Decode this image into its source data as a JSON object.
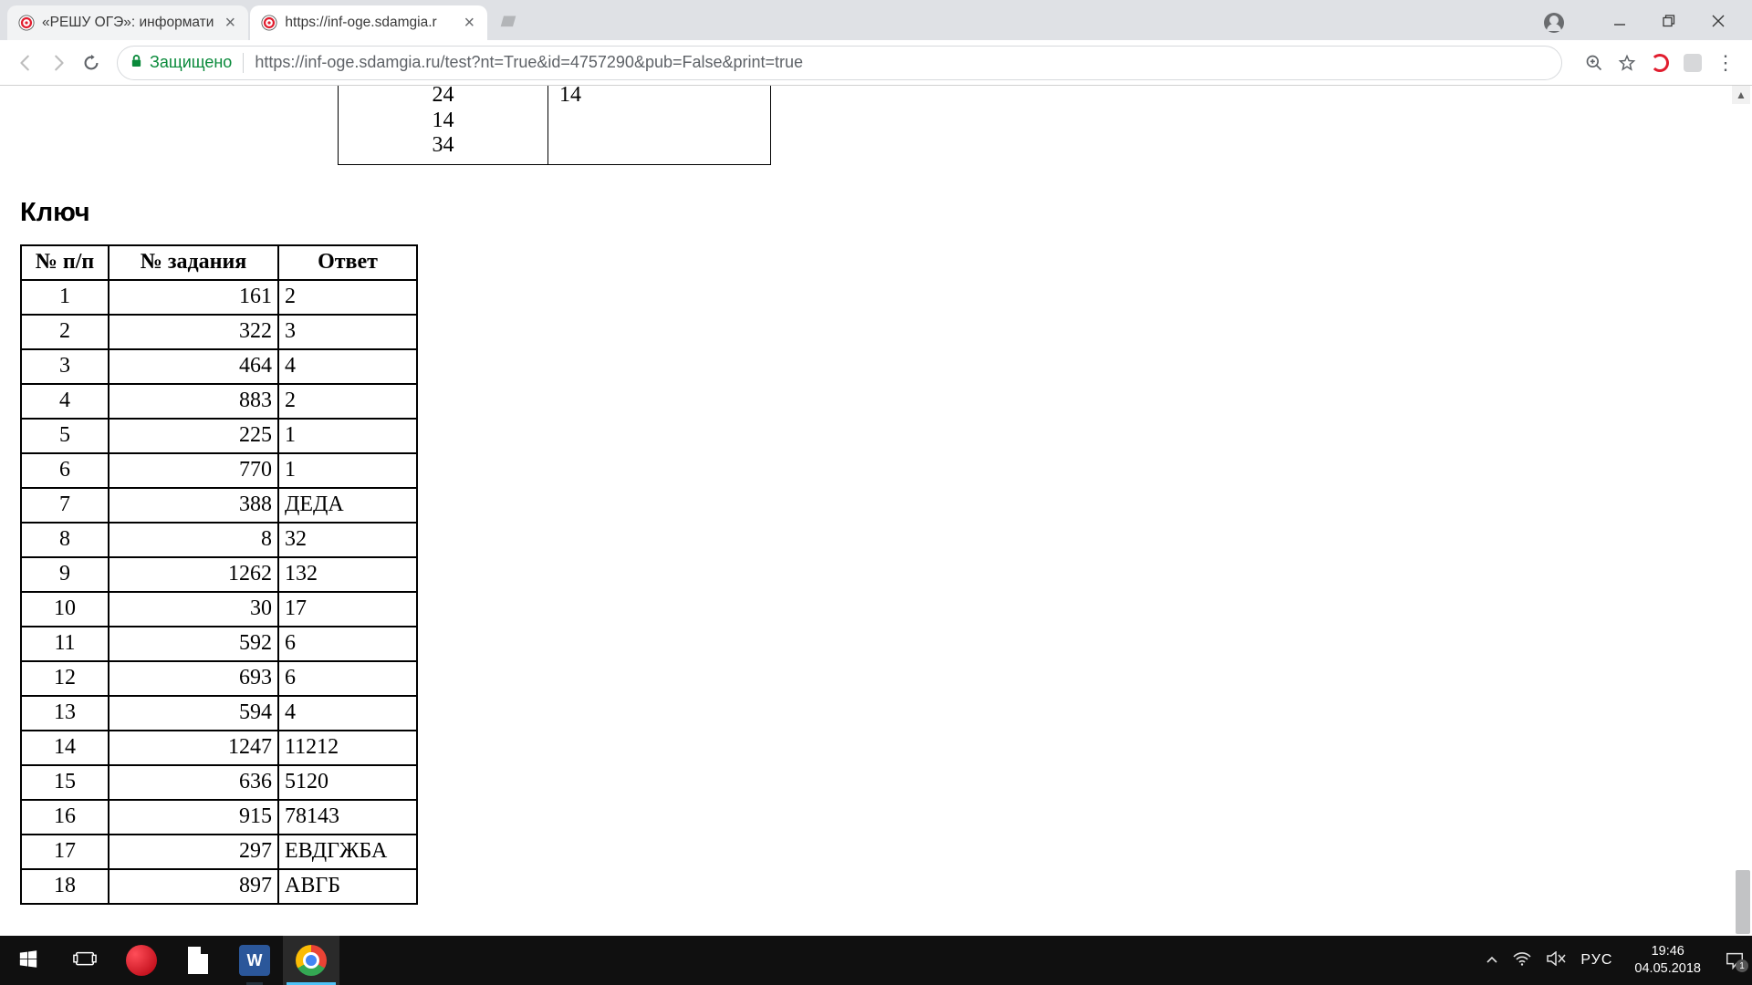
{
  "tabs": [
    {
      "title": "«РЕШУ ОГЭ»: информати",
      "active": false
    },
    {
      "title": "https://inf-oge.sdamgia.r",
      "active": true
    }
  ],
  "addressbar": {
    "secure_label": "Защищено",
    "url_scheme": "https://",
    "url_host": "inf-oge.sdamgia.ru",
    "url_path": "/test?nt=True&id=4757290&pub=False&print=true"
  },
  "page": {
    "top_cells": {
      "left_lines": [
        "24",
        "14",
        "34"
      ],
      "right": "14"
    },
    "key_title": "Ключ",
    "key_headers": {
      "pp": "№ п/п",
      "task": "№ задания",
      "ans": "Ответ"
    },
    "rows": [
      {
        "pp": "1",
        "task": "161",
        "ans": "2"
      },
      {
        "pp": "2",
        "task": "322",
        "ans": "3"
      },
      {
        "pp": "3",
        "task": "464",
        "ans": "4"
      },
      {
        "pp": "4",
        "task": "883",
        "ans": "2"
      },
      {
        "pp": "5",
        "task": "225",
        "ans": "1"
      },
      {
        "pp": "6",
        "task": "770",
        "ans": "1"
      },
      {
        "pp": "7",
        "task": "388",
        "ans": "ДЕДА"
      },
      {
        "pp": "8",
        "task": "8",
        "ans": "32"
      },
      {
        "pp": "9",
        "task": "1262",
        "ans": "132"
      },
      {
        "pp": "10",
        "task": "30",
        "ans": "17"
      },
      {
        "pp": "11",
        "task": "592",
        "ans": "6"
      },
      {
        "pp": "12",
        "task": "693",
        "ans": "6"
      },
      {
        "pp": "13",
        "task": "594",
        "ans": "4"
      },
      {
        "pp": "14",
        "task": "1247",
        "ans": "11212"
      },
      {
        "pp": "15",
        "task": "636",
        "ans": "5120"
      },
      {
        "pp": "16",
        "task": "915",
        "ans": "78143"
      },
      {
        "pp": "17",
        "task": "297",
        "ans": "ЕВДГЖБА"
      },
      {
        "pp": "18",
        "task": "897",
        "ans": "АВГБ"
      }
    ]
  },
  "taskbar": {
    "lang": "РУС",
    "time": "19:46",
    "date": "04.05.2018",
    "notif_count": "1",
    "word_letter": "W"
  }
}
